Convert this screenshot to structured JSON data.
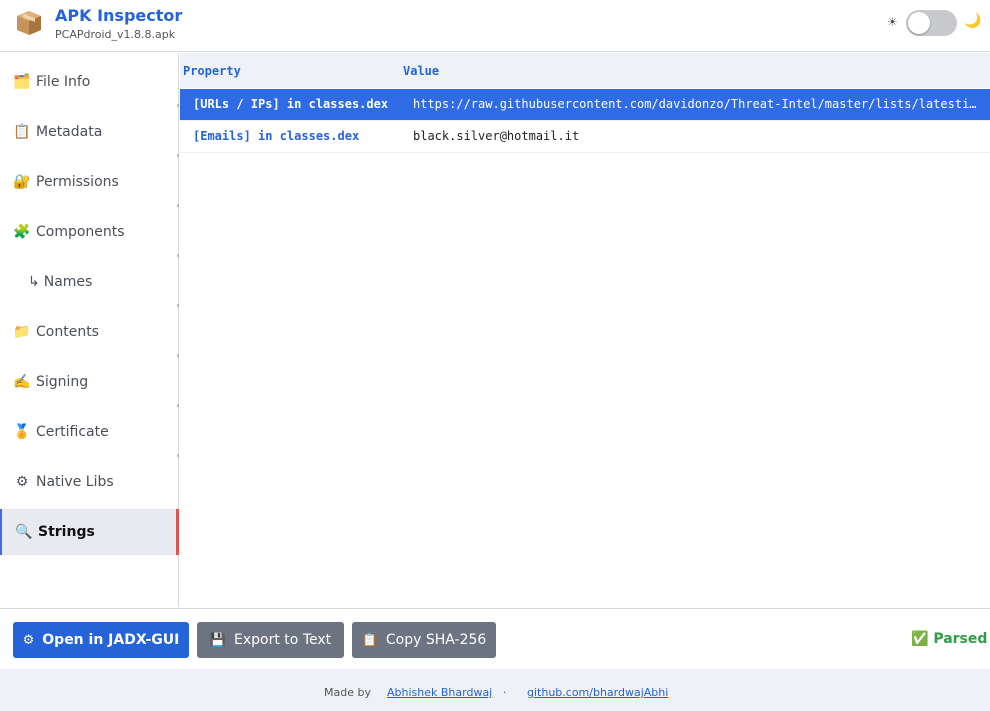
{
  "header": {
    "title": "APK Inspector",
    "subtitle": "PCAPdroid_v1.8.8.apk",
    "logo_icon": "package-icon",
    "sun_glyph": "☀",
    "moon_glyph": "🌙"
  },
  "sidebar": {
    "items": [
      {
        "icon": "🗂️",
        "label": "File Info"
      },
      {
        "icon": "📋",
        "label": "Metadata"
      },
      {
        "icon": "🔐",
        "label": "Permissions"
      },
      {
        "icon": "🧩",
        "label": "Components"
      },
      {
        "icon": "↳",
        "label": "Names"
      },
      {
        "icon": "📁",
        "label": "Contents"
      },
      {
        "icon": "✍️",
        "label": "Signing"
      },
      {
        "icon": "🏅",
        "label": "Certificate"
      },
      {
        "icon": "⚙",
        "label": "Native Libs"
      },
      {
        "icon": "🔍",
        "label": "Strings"
      }
    ],
    "active": "Strings"
  },
  "table": {
    "headers": {
      "property": "Property",
      "value": "Value"
    },
    "rows": [
      {
        "property": "[URLs / IPs] in classes.dex",
        "value": "https://raw.githubusercontent.com/davidonzo/Threat-Intel/master/lists/latestips.txt"
      },
      {
        "property": "[Emails] in classes.dex",
        "value": "black.silver@hotmail.it"
      }
    ]
  },
  "toolbar": {
    "open_icon": "⚙",
    "open_label": "Open in JADX-GUI",
    "export_icon": "💾",
    "export_label": "Export to Text",
    "copy_icon": "📋",
    "copy_label": "Copy SHA-256",
    "status_icon": "✅",
    "status_label": "Parsed"
  },
  "footer": {
    "made_by": "Made by",
    "author": "Abhishek Bhardwaj",
    "separator": "·",
    "repo": "github.com/bhardwajAbhi"
  },
  "colors": {
    "accent": "#2563d9",
    "selected_row": "#2e6be5",
    "secondary_button": "#6b7480",
    "status_ok": "#2e9e48"
  }
}
